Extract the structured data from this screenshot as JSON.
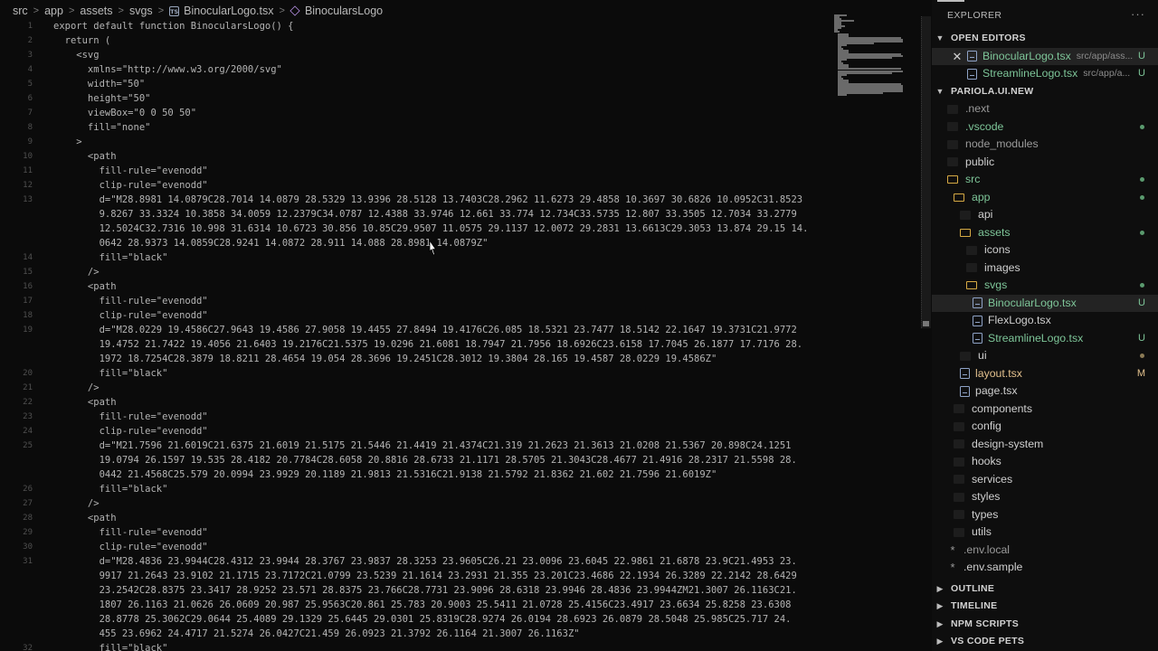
{
  "breadcrumb": {
    "items": [
      "src",
      "app",
      "assets",
      "svgs",
      "BinocularLogo.tsx",
      "BinocularsLogo"
    ],
    "separator": ">"
  },
  "code": {
    "lines": [
      {
        "n": "1",
        "text": "export default function BinocularsLogo() {"
      },
      {
        "n": "2",
        "text": "  return ("
      },
      {
        "n": "3",
        "text": "    <svg"
      },
      {
        "n": "4",
        "text": "      xmlns=\"http://www.w3.org/2000/svg\""
      },
      {
        "n": "5",
        "text": "      width=\"50\""
      },
      {
        "n": "6",
        "text": "      height=\"50\""
      },
      {
        "n": "7",
        "text": "      viewBox=\"0 0 50 50\""
      },
      {
        "n": "8",
        "text": "      fill=\"none\""
      },
      {
        "n": "9",
        "text": "    >"
      },
      {
        "n": "10",
        "text": "      <path"
      },
      {
        "n": "11",
        "text": "        fill-rule=\"evenodd\""
      },
      {
        "n": "12",
        "text": "        clip-rule=\"evenodd\""
      },
      {
        "n": "13",
        "text": "        d=\"M28.8981 14.0879C28.7014 14.0879 28.5329 13.9396 28.5128 13.7403C28.2962 11.6273 29.4858 10.3697 30.6826 10.0952C31.8523"
      },
      {
        "n": "",
        "text": "        9.8267 33.3324 10.3858 34.0059 12.2379C34.0787 12.4388 33.9746 12.661 33.774 12.734C33.5735 12.807 33.3505 12.7034 33.2779"
      },
      {
        "n": "",
        "text": "        12.5024C32.7316 10.998 31.6314 10.6723 30.856 10.85C29.9507 11.0575 29.1137 12.0072 29.2831 13.6613C29.3053 13.874 29.15 14."
      },
      {
        "n": "",
        "text": "        0642 28.9373 14.0859C28.9241 14.0872 28.911 14.088 28.8981 14.0879Z\""
      },
      {
        "n": "14",
        "text": "        fill=\"black\""
      },
      {
        "n": "15",
        "text": "      />"
      },
      {
        "n": "16",
        "text": "      <path"
      },
      {
        "n": "17",
        "text": "        fill-rule=\"evenodd\""
      },
      {
        "n": "18",
        "text": "        clip-rule=\"evenodd\""
      },
      {
        "n": "19",
        "text": "        d=\"M28.0229 19.4586C27.9643 19.4586 27.9058 19.4455 27.8494 19.4176C26.085 18.5321 23.7477 18.5142 22.1647 19.3731C21.9772"
      },
      {
        "n": "",
        "text": "        19.4752 21.7422 19.4056 21.6403 19.2176C21.5375 19.0296 21.6081 18.7947 21.7956 18.6926C23.6158 17.7045 26.1877 17.7176 28."
      },
      {
        "n": "",
        "text": "        1972 18.7254C28.3879 18.8211 28.4654 19.054 28.3696 19.2451C28.3012 19.3804 28.165 19.4587 28.0229 19.4586Z\""
      },
      {
        "n": "20",
        "text": "        fill=\"black\""
      },
      {
        "n": "21",
        "text": "      />"
      },
      {
        "n": "22",
        "text": "      <path"
      },
      {
        "n": "23",
        "text": "        fill-rule=\"evenodd\""
      },
      {
        "n": "24",
        "text": "        clip-rule=\"evenodd\""
      },
      {
        "n": "25",
        "text": "        d=\"M21.7596 21.6019C21.6375 21.6019 21.5175 21.5446 21.4419 21.4374C21.319 21.2623 21.3613 21.0208 21.5367 20.898C24.1251"
      },
      {
        "n": "",
        "text": "        19.0794 26.1597 19.535 28.4182 20.7784C28.6058 20.8816 28.6733 21.1171 28.5705 21.3043C28.4677 21.4916 28.2317 21.5598 28."
      },
      {
        "n": "",
        "text": "        0442 21.4568C25.579 20.0994 23.9929 20.1189 21.9813 21.5316C21.9138 21.5792 21.8362 21.602 21.7596 21.6019Z\""
      },
      {
        "n": "26",
        "text": "        fill=\"black\""
      },
      {
        "n": "27",
        "text": "      />"
      },
      {
        "n": "28",
        "text": "      <path"
      },
      {
        "n": "29",
        "text": "        fill-rule=\"evenodd\""
      },
      {
        "n": "30",
        "text": "        clip-rule=\"evenodd\""
      },
      {
        "n": "31",
        "text": "        d=\"M28.4836 23.9944C28.4312 23.9944 28.3767 23.9837 28.3253 23.9605C26.21 23.0096 23.6045 22.9861 21.6878 23.9C21.4953 23."
      },
      {
        "n": "",
        "text": "        9917 21.2643 23.9102 21.1715 23.7172C21.0799 23.5239 21.1614 23.2931 21.355 23.201C23.4686 22.1934 26.3289 22.2142 28.6429"
      },
      {
        "n": "",
        "text": "        23.2542C28.8375 23.3417 28.9252 23.571 28.8375 23.766C28.7731 23.9096 28.6318 23.9946 28.4836 23.9944ZM21.3007 26.1163C21."
      },
      {
        "n": "",
        "text": "        1807 26.1163 21.0626 26.0609 20.987 25.9563C20.861 25.783 20.9003 25.5411 21.0728 25.4156C23.4917 23.6634 25.8258 23.6308"
      },
      {
        "n": "",
        "text": "        28.8778 25.3062C29.0644 25.4089 29.1329 25.6445 29.0301 25.8319C28.9274 26.0194 28.6923 26.0879 28.5048 25.985C25.717 24."
      },
      {
        "n": "",
        "text": "        455 23.6962 24.4717 21.5274 26.0427C21.459 26.0923 21.3792 26.1164 21.3007 26.1163Z\""
      },
      {
        "n": "32",
        "text": "        fill=\"black\""
      }
    ]
  },
  "sidebar": {
    "title": "EXPLORER",
    "more": "···",
    "open_editors": {
      "label": "OPEN EDITORS",
      "items": [
        {
          "name": "BinocularLogo.tsx",
          "path": "src/app/ass...",
          "badge": "U"
        },
        {
          "name": "StreamlineLogo.tsx",
          "path": "src/app/a...",
          "badge": "U"
        }
      ]
    },
    "project": {
      "label": "PARIOLA.UI.NEW",
      "items": [
        {
          "name": ".next"
        },
        {
          "name": ".vscode"
        },
        {
          "name": "node_modules"
        },
        {
          "name": "public"
        },
        {
          "name": "src"
        },
        {
          "name": "app"
        },
        {
          "name": "api"
        },
        {
          "name": "assets"
        },
        {
          "name": "icons"
        },
        {
          "name": "images"
        },
        {
          "name": "svgs"
        },
        {
          "name": "BinocularLogo.tsx",
          "badge": "U"
        },
        {
          "name": "FlexLogo.tsx"
        },
        {
          "name": "StreamlineLogo.tsx",
          "badge": "U"
        },
        {
          "name": "ui"
        },
        {
          "name": "layout.tsx",
          "badge": "M"
        },
        {
          "name": "page.tsx"
        },
        {
          "name": "components"
        },
        {
          "name": "config"
        },
        {
          "name": "design-system"
        },
        {
          "name": "hooks"
        },
        {
          "name": "services"
        },
        {
          "name": "styles"
        },
        {
          "name": "types"
        },
        {
          "name": "utils"
        },
        {
          "name": ".env.local"
        },
        {
          "name": ".env.sample"
        }
      ]
    },
    "sections": [
      "OUTLINE",
      "TIMELINE",
      "NPM SCRIPTS",
      "VS CODE PETS"
    ]
  },
  "colors": {
    "untracked": "#7ec699",
    "modified": "#e2c08d",
    "folder": "#d6aa44"
  }
}
